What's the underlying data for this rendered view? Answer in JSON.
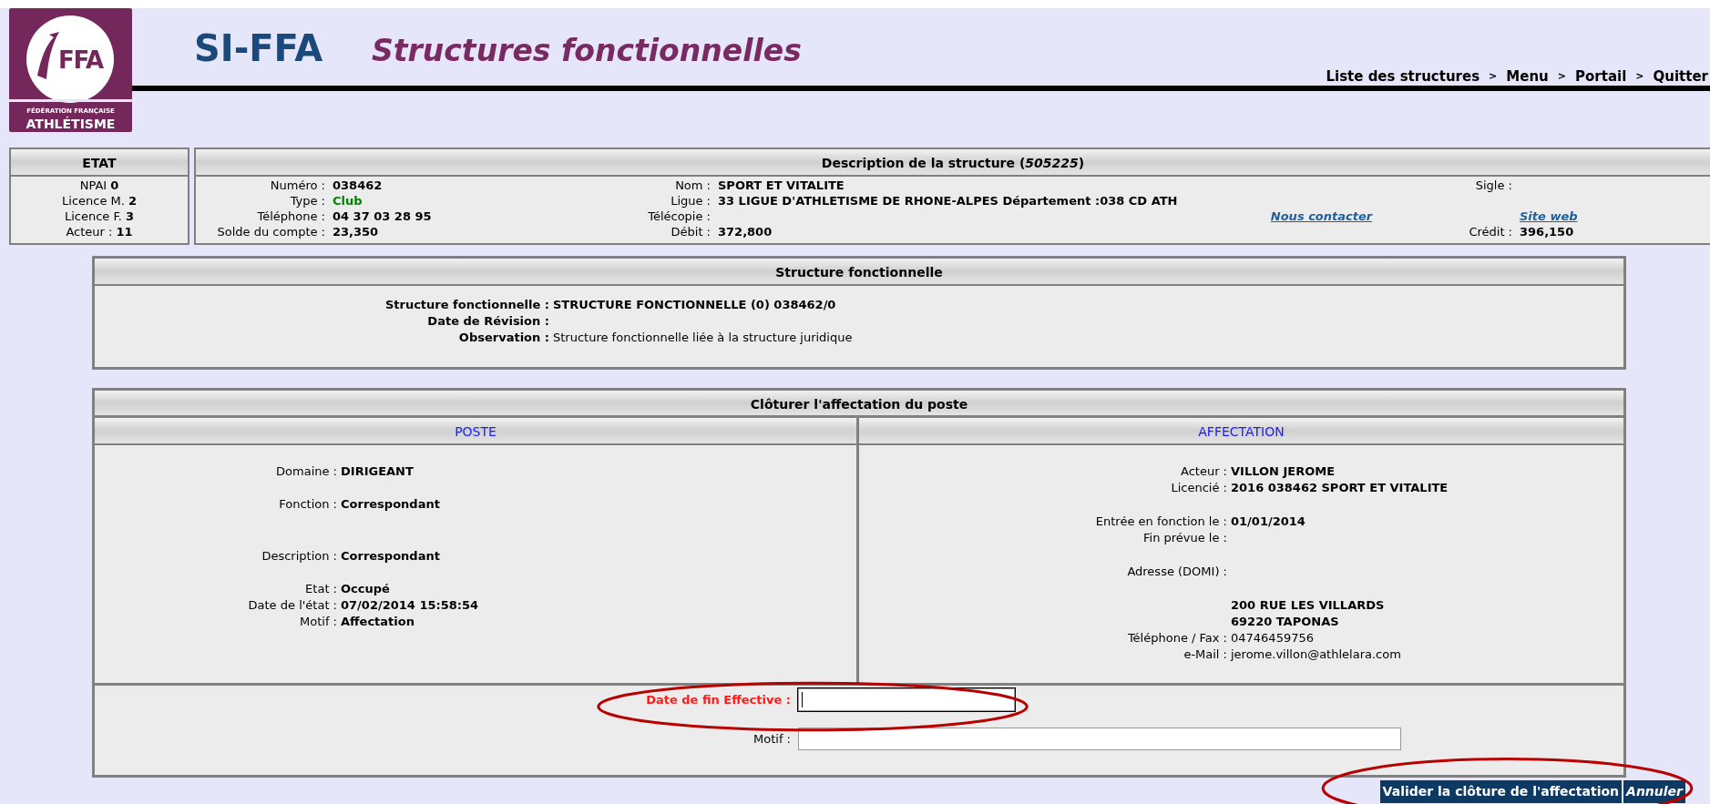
{
  "logo": {
    "mark": "FFA",
    "line1": "FÉDÉRATION FRANÇAISE",
    "line2": "ATHLÉTISME"
  },
  "header": {
    "app": "SI-FFA",
    "title": "Structures fonctionnelles"
  },
  "nav": [
    {
      "label": "Liste des structures"
    },
    {
      "label": "Menu"
    },
    {
      "label": "Portail"
    },
    {
      "label": "Quitter"
    }
  ],
  "nav_separator": ">",
  "etat": {
    "title": "ETAT",
    "rows": [
      {
        "label": "NPAI",
        "value": "0"
      },
      {
        "label": "Licence M.",
        "value": "2"
      },
      {
        "label": "Licence F.",
        "value": "3"
      },
      {
        "label": "Acteur :",
        "value": "11"
      }
    ]
  },
  "description": {
    "title": "Description de la structure (",
    "number": "505225",
    "title_end": ")",
    "rows": [
      {
        "left": {
          "label": "Numéro :",
          "value": "038462"
        },
        "middle": {
          "label": "Nom :",
          "value": "SPORT ET VITALITE"
        },
        "right": {
          "label": "Sigle :"
        }
      },
      {
        "left": {
          "label": "Type :",
          "value": "Club",
          "color": "#008000"
        },
        "middle": {
          "label": "Ligue :",
          "value": "33 LIGUE D'ATHLETISME DE RHONE-ALPES Département :038 CD ATH"
        }
      },
      {
        "left": {
          "label": "Téléphone :",
          "value": "04 37 03 28 95"
        },
        "middle": {
          "label": "Télécopie :"
        },
        "contact": {
          "link": "Nous contacter"
        },
        "right": {
          "link": "Site web"
        }
      },
      {
        "left": {
          "label": "Solde du compte :",
          "value": "23,350"
        },
        "middle": {
          "label": "Débit :",
          "value": "372,800"
        },
        "right": {
          "label": "Crédit :",
          "value": "396,150"
        }
      }
    ]
  },
  "structure": {
    "title": "Structure fonctionnelle",
    "fields": [
      {
        "label": "Structure fonctionnelle :",
        "value": "STRUCTURE FONCTIONNELLE (0) 038462/0",
        "bold": true
      },
      {
        "label": "Date de Révision :"
      },
      {
        "label": "Observation :",
        "value": "Structure fonctionnelle liée à la structure juridique",
        "bold": false
      }
    ]
  },
  "cloture": {
    "title": "Clôturer l'affectation du poste",
    "poste": {
      "title": "POSTE",
      "groups": [
        [
          {
            "label": "Domaine :",
            "value": "DIRIGEANT",
            "bold": true
          }
        ],
        [
          {
            "label": "Fonction :",
            "value": "Correspondant",
            "bold": true
          }
        ],
        [
          {
            "label": "Description :",
            "value": "Correspondant",
            "bold": true
          }
        ],
        [
          {
            "label": "Etat :",
            "value": "Occupé",
            "bold": true
          },
          {
            "label": "Date de l'état :",
            "value": "07/02/2014 15:58:54",
            "bold": true
          },
          {
            "label": "Motif :",
            "value": "Affectation",
            "bold": true
          }
        ]
      ]
    },
    "affectation": {
      "title": "AFFECTATION",
      "groups": [
        [
          {
            "label": "Acteur :",
            "value": "VILLON JEROME",
            "bold": true
          },
          {
            "label": "Licencié :",
            "value": "2016 038462 SPORT ET VITALITE",
            "bold": true
          }
        ],
        [
          {
            "label": "Entrée en fonction le :",
            "value": "01/01/2014",
            "bold": true
          },
          {
            "label": "Fin prévue le :"
          }
        ],
        [
          {
            "label": "Adresse (DOMI) :"
          }
        ],
        [
          {
            "value": "200 RUE LES VILLARDS",
            "bold": true
          },
          {
            "value": "69220 TAPONAS",
            "bold": true
          },
          {
            "label": "Téléphone / Fax :",
            "value": "04746459756",
            "bold": false
          },
          {
            "label": "e-Mail :",
            "value": "jerome.villon@athlelara.com",
            "bold": false
          }
        ]
      ]
    },
    "form": [
      {
        "label": "Date de fin Effective :",
        "required": true,
        "focused": true,
        "circled": true
      },
      {
        "label": "Motif :",
        "required": false,
        "focused": false,
        "circled": false
      }
    ]
  },
  "actions": [
    {
      "label": "Valider la clôture de l'affectation",
      "kind": "primary",
      "circled": true
    },
    {
      "label": "Annuler",
      "kind": "secondary",
      "circled": false
    }
  ]
}
